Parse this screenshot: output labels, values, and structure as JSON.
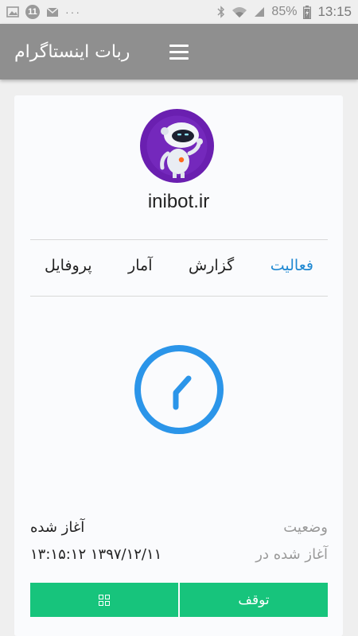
{
  "status_bar": {
    "notification_count": "11",
    "dots": "···",
    "battery": "85%",
    "time": "13:15",
    "icons": [
      "image-icon",
      "notification-badge",
      "mail-icon",
      "bluetooth-icon",
      "wifi-icon",
      "signal-icon",
      "battery-charging-icon"
    ]
  },
  "app_bar": {
    "title": "ربات اینستاگرام",
    "menu_icon": "hamburger-menu-icon"
  },
  "profile": {
    "username": "inibot.ir",
    "avatar_icon": "robot-avatar"
  },
  "tabs": [
    {
      "label": "فعالیت",
      "active": true
    },
    {
      "label": "گزارش",
      "active": false
    },
    {
      "label": "آمار",
      "active": false
    },
    {
      "label": "پروفایل",
      "active": false
    }
  ],
  "status_clock_icon": "clock-icon",
  "info": {
    "status_label": "وضعیت",
    "status_value": "آغاز شده",
    "started_label": "آغاز شده در",
    "started_value": "۱۳:۱۵:۱۲ ۱۳۹۷/۱۲/۱۱"
  },
  "actions": {
    "stop_label": "توقف",
    "grid_icon": "grid-icon"
  },
  "colors": {
    "app_bar": "#8f8f8f",
    "accent_tab": "#1e88d2",
    "button": "#17c47c",
    "clock": "#2b95e9",
    "avatar_bg": "#6a1fb0"
  }
}
